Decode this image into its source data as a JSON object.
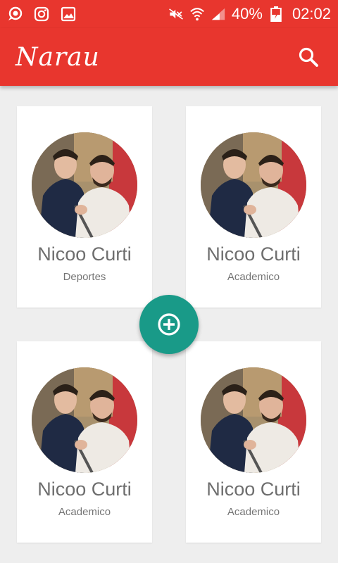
{
  "status_bar": {
    "battery": "40%",
    "time": "02:02"
  },
  "app_bar": {
    "title": "Narau"
  },
  "cards": [
    {
      "name": "Nicoo Curti",
      "category": "Deportes"
    },
    {
      "name": "Nicoo Curti",
      "category": "Academico"
    },
    {
      "name": "Nicoo Curti",
      "category": "Academico"
    },
    {
      "name": "Nicoo Curti",
      "category": "Academico"
    }
  ],
  "colors": {
    "primary": "#e8362e",
    "fab": "#199a88",
    "background": "#eeeeee"
  },
  "icons": {
    "status_left": [
      "chat-bubble-icon",
      "instagram-icon",
      "image-icon"
    ],
    "status_right": [
      "mute-icon",
      "wifi-icon",
      "signal-icon",
      "battery-icon"
    ],
    "app_bar": "search-icon",
    "fab": "add-circle-icon"
  }
}
